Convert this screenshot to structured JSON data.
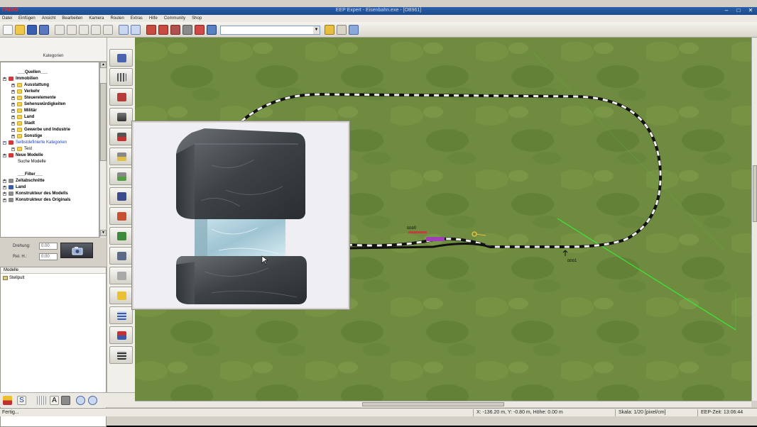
{
  "window": {
    "logo": "TREND",
    "title": "EEP Expert - Eisenbahn.exe - [OB961]"
  },
  "menu": [
    "Datei",
    "Einfügen",
    "Ansicht",
    "Bearbeiten",
    "Kamera",
    "Routen",
    "Extras",
    "Hilfe",
    "Community",
    "Shop"
  ],
  "toolbar": {
    "combo_value": ""
  },
  "left_panel": {
    "header": "Kategorien",
    "tree": [
      {
        "label": "___Quellen___",
        "level": 0,
        "style": "b",
        "icon": "none"
      },
      {
        "label": "Immobilien",
        "level": 0,
        "style": "b",
        "icon": "red"
      },
      {
        "label": "Ausstattung",
        "level": 1,
        "style": "b",
        "icon": "folder"
      },
      {
        "label": "Verkehr",
        "level": 1,
        "style": "b",
        "icon": "folder"
      },
      {
        "label": "Steuerelemente",
        "level": 1,
        "style": "b",
        "icon": "folder"
      },
      {
        "label": "Sehenswürdigkeiten",
        "level": 1,
        "style": "b",
        "icon": "folder"
      },
      {
        "label": "Militär",
        "level": 1,
        "style": "b",
        "icon": "folder"
      },
      {
        "label": "Land",
        "level": 1,
        "style": "b",
        "icon": "folder"
      },
      {
        "label": "Stadt",
        "level": 1,
        "style": "b",
        "icon": "folder"
      },
      {
        "label": "Gewerbe und Industrie",
        "level": 1,
        "style": "b",
        "icon": "folder"
      },
      {
        "label": "Sonstige",
        "level": 1,
        "style": "b",
        "icon": "folder"
      },
      {
        "label": "Selbstdefinierte Kategorien",
        "level": 0,
        "style": "blue",
        "icon": "red"
      },
      {
        "label": "Test",
        "level": 1,
        "style": "",
        "icon": "folder"
      },
      {
        "label": "Neue Modelle",
        "level": 0,
        "style": "b",
        "icon": "red"
      },
      {
        "label": "Suche Modelle",
        "level": 0,
        "style": "",
        "icon": "none"
      },
      {
        "label": "",
        "level": 0,
        "style": "",
        "icon": "none"
      },
      {
        "label": "___Filter___",
        "level": 0,
        "style": "b",
        "icon": "none"
      },
      {
        "label": "Zeitabschnitte",
        "level": 0,
        "style": "b",
        "icon": "gray"
      },
      {
        "label": "Land",
        "level": 0,
        "style": "b",
        "icon": "blue"
      },
      {
        "label": "Konstrukteur des Modells",
        "level": 0,
        "style": "b",
        "icon": "gray"
      },
      {
        "label": "Konstrukteur des Originals",
        "level": 0,
        "style": "b",
        "icon": "gray"
      }
    ],
    "props": {
      "rotation_label": "Drehung:",
      "rotation_value": "0.00",
      "height_label": "Rel. H.:",
      "height_value": "0.00"
    },
    "models": {
      "header": "Modelle",
      "rows": [
        "Stellpult"
      ]
    }
  },
  "viewport": {
    "label_marker_top": "ᴅᴅᴅ0",
    "label_marker_bottom": "ᴅᴅᴅ1"
  },
  "statusbar": {
    "status": "Fertig...",
    "coords": "X: -136.20 m, Y: -0.80 m, Höhe: 0.00 m",
    "scale": "Skala: 1/20 [pixel/cm]",
    "time": "EEP-Zeit: 13:06:44"
  }
}
